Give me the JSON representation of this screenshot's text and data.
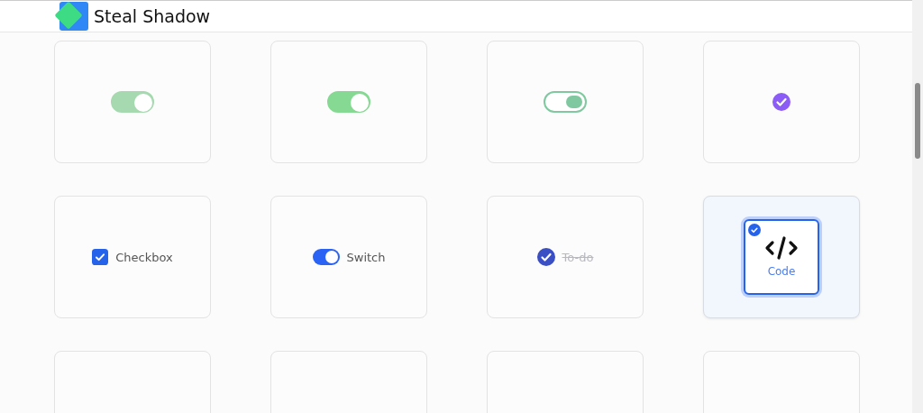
{
  "header": {
    "title": "Steal Shadow"
  },
  "cards": [
    {
      "kind": "pill",
      "on": true
    },
    {
      "kind": "toggle",
      "on": true
    },
    {
      "kind": "ring",
      "on": true
    },
    {
      "kind": "check-circle",
      "checked": true
    },
    {
      "kind": "checkbox",
      "label": "Checkbox",
      "checked": true
    },
    {
      "kind": "switch",
      "label": "Switch",
      "on": true
    },
    {
      "kind": "todo",
      "label": "To-do",
      "done": true
    },
    {
      "kind": "option",
      "label": "Code",
      "selected": true
    },
    {
      "kind": "empty"
    },
    {
      "kind": "empty"
    },
    {
      "kind": "empty"
    },
    {
      "kind": "empty"
    }
  ]
}
